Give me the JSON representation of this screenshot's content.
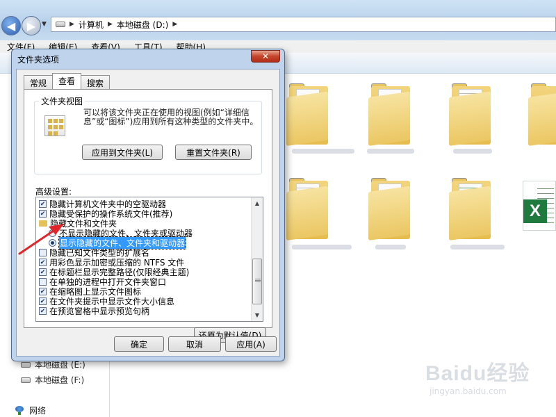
{
  "explorer": {
    "breadcrumb": [
      "计算机",
      "本地磁盘 (D:)"
    ],
    "menu": [
      "文件(F)",
      "编辑(E)",
      "查看(V)",
      "工具(T)",
      "帮助(H)"
    ],
    "tree": [
      "本地磁盘 (E:)",
      "本地磁盘 (F:)",
      "网络"
    ]
  },
  "dialog": {
    "title": "文件夹选项",
    "close_label": "✕",
    "tabs": [
      "常规",
      "查看",
      "搜索"
    ],
    "active_tab": "查看",
    "folder_view": {
      "legend": "文件夹视图",
      "description": "可以将该文件夹正在使用的视图(例如“详细信息”或“图标”)应用到所有这种类型的文件夹中。",
      "apply_button": "应用到文件夹(L)",
      "reset_button": "重置文件夹(R)"
    },
    "advanced": {
      "label": "高级设置:",
      "items": [
        {
          "kind": "checkbox",
          "checked": true,
          "text": "隐藏计算机文件夹中的空驱动器"
        },
        {
          "kind": "checkbox",
          "checked": true,
          "text": "隐藏受保护的操作系统文件(推荐)"
        },
        {
          "kind": "folder",
          "text": "隐藏文件和文件夹"
        },
        {
          "kind": "radio",
          "checked": false,
          "text": "不显示隐藏的文件、文件夹或驱动器"
        },
        {
          "kind": "radio",
          "checked": true,
          "selected": true,
          "text": "显示隐藏的文件、文件夹和驱动器"
        },
        {
          "kind": "checkbox",
          "checked": false,
          "text": "隐藏已知文件类型的扩展名"
        },
        {
          "kind": "checkbox",
          "checked": true,
          "text": "用彩色显示加密或压缩的 NTFS 文件"
        },
        {
          "kind": "checkbox",
          "checked": true,
          "text": "在标题栏显示完整路径(仅限经典主题)"
        },
        {
          "kind": "checkbox",
          "checked": false,
          "text": "在单独的进程中打开文件夹窗口"
        },
        {
          "kind": "checkbox",
          "checked": true,
          "text": "在缩略图上显示文件图标"
        },
        {
          "kind": "checkbox",
          "checked": true,
          "text": "在文件夹提示中显示文件大小信息"
        },
        {
          "kind": "checkbox",
          "checked": true,
          "text": "在预览窗格中显示预览句柄"
        }
      ],
      "restore_button": "还原为默认值(D)"
    },
    "ok_button": "确定",
    "cancel_button": "取消",
    "apply_button": "应用(A)"
  },
  "watermark": {
    "brand": "Baidu经验",
    "site": "jingyan.baidu.com"
  },
  "colors": {
    "annotation_arrow": "#e0262a",
    "selection": "#3399ff",
    "close_button": "#c5452b"
  }
}
